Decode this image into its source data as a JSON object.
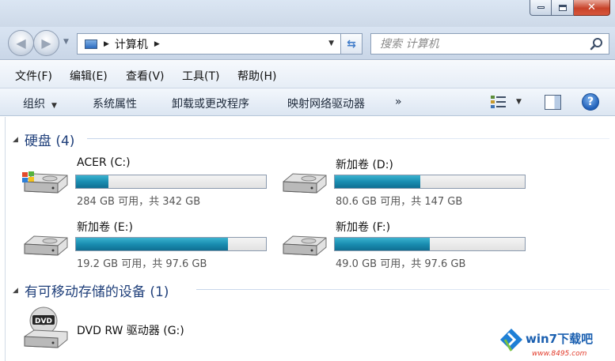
{
  "window": {
    "controls": {
      "minimize": "minimize-icon",
      "maximize": "maximize-icon",
      "close": "close-icon"
    }
  },
  "address_bar": {
    "path": "计算机",
    "search_placeholder": "搜索 计算机"
  },
  "menu": [
    {
      "label": "文件(F)"
    },
    {
      "label": "编辑(E)"
    },
    {
      "label": "查看(V)"
    },
    {
      "label": "工具(T)"
    },
    {
      "label": "帮助(H)"
    }
  ],
  "toolbar": {
    "organize": "组织",
    "system_properties": "系统属性",
    "uninstall": "卸载或更改程序",
    "map_drive": "映射网络驱动器",
    "more": "»"
  },
  "groups": {
    "hard_disks": {
      "label": "硬盘 (4)"
    },
    "removable": {
      "label": "有可移动存储的设备 (1)"
    }
  },
  "drives": [
    {
      "label": "ACER (C:)",
      "free": "284 GB 可用，共 342 GB",
      "used_fraction": 0.17,
      "icon": "windows-drive-icon"
    },
    {
      "label": "新加卷 (D:)",
      "free": "80.6 GB 可用，共 147 GB",
      "used_fraction": 0.45,
      "icon": "hard-drive-icon"
    },
    {
      "label": "新加卷 (E:)",
      "free": "19.2 GB 可用，共 97.6 GB",
      "used_fraction": 0.8,
      "icon": "hard-drive-icon"
    },
    {
      "label": "新加卷 (F:)",
      "free": "49.0 GB 可用，共 97.6 GB",
      "used_fraction": 0.5,
      "icon": "hard-drive-icon"
    }
  ],
  "dvd": {
    "label": "DVD RW 驱动器 (G:)",
    "icon": "dvd-drive-icon"
  },
  "watermark": {
    "brand": "win7下载吧",
    "url": "www.8495.com"
  },
  "colors": {
    "bar_fill": "#1a8db1",
    "group_header": "#1f3f7a"
  }
}
